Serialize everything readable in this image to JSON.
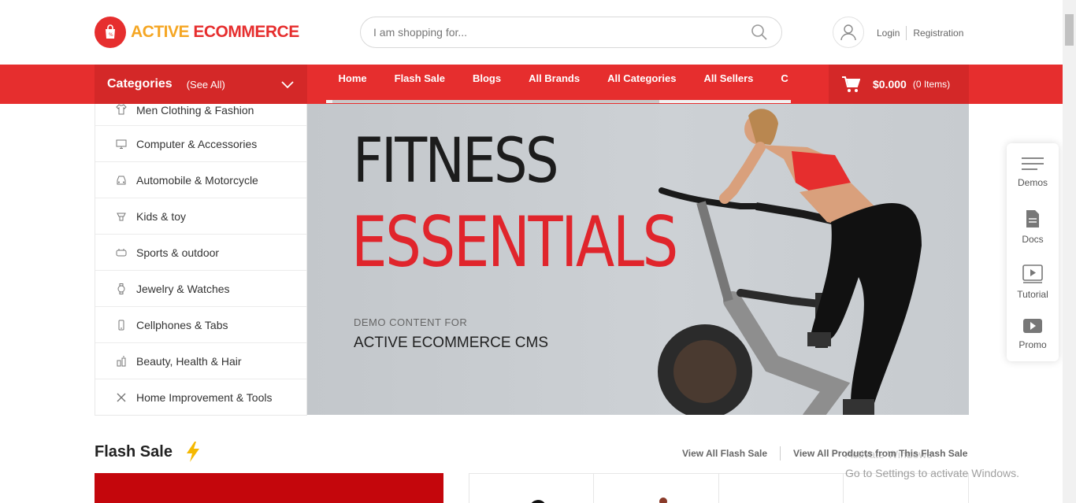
{
  "brand": {
    "name_part1": "ACTIVE",
    "name_part2": "ECOMMERCE",
    "color_primary": "#e62e2e",
    "color_accent": "#f5a623"
  },
  "search": {
    "placeholder": "I am shopping for...",
    "value": ""
  },
  "auth": {
    "login": "Login",
    "register": "Registration"
  },
  "categories_header": {
    "title": "Categories",
    "see_all": "(See All)"
  },
  "nav": [
    {
      "label": "Home"
    },
    {
      "label": "Flash Sale"
    },
    {
      "label": "Blogs"
    },
    {
      "label": "All Brands"
    },
    {
      "label": "All Categories"
    },
    {
      "label": "All Sellers"
    },
    {
      "label": "C"
    }
  ],
  "cart": {
    "amount": "$0.000",
    "items": "(0 Items)"
  },
  "categories": [
    {
      "label": "Men Clothing & Fashion",
      "icon": "shirt-icon"
    },
    {
      "label": "Computer & Accessories",
      "icon": "monitor-icon"
    },
    {
      "label": "Automobile & Motorcycle",
      "icon": "car-icon"
    },
    {
      "label": "Kids & toy",
      "icon": "toy-icon"
    },
    {
      "label": "Sports & outdoor",
      "icon": "sports-icon"
    },
    {
      "label": "Jewelry & Watches",
      "icon": "watch-icon"
    },
    {
      "label": "Cellphones & Tabs",
      "icon": "phone-icon"
    },
    {
      "label": "Beauty, Health & Hair",
      "icon": "beauty-icon"
    },
    {
      "label": "Home Improvement & Tools",
      "icon": "tools-icon"
    }
  ],
  "banner": {
    "line1": "FITNESS",
    "line2": "ESSENTIALS",
    "small": "DEMO CONTENT FOR",
    "cms": "ACTIVE ECOMMERCE CMS"
  },
  "floating": [
    {
      "label": "Demos",
      "icon": "menu-lines-icon"
    },
    {
      "label": "Docs",
      "icon": "document-icon"
    },
    {
      "label": "Tutorial",
      "icon": "play-outline-icon"
    },
    {
      "label": "Promo",
      "icon": "play-filled-icon"
    }
  ],
  "flash_sale": {
    "title": "Flash Sale",
    "link_all": "View All Flash Sale",
    "link_products": "View All Products from This Flash Sale"
  },
  "windows_watermark": {
    "line1": "Activate Windows",
    "line2": "Go to Settings to activate Windows."
  }
}
